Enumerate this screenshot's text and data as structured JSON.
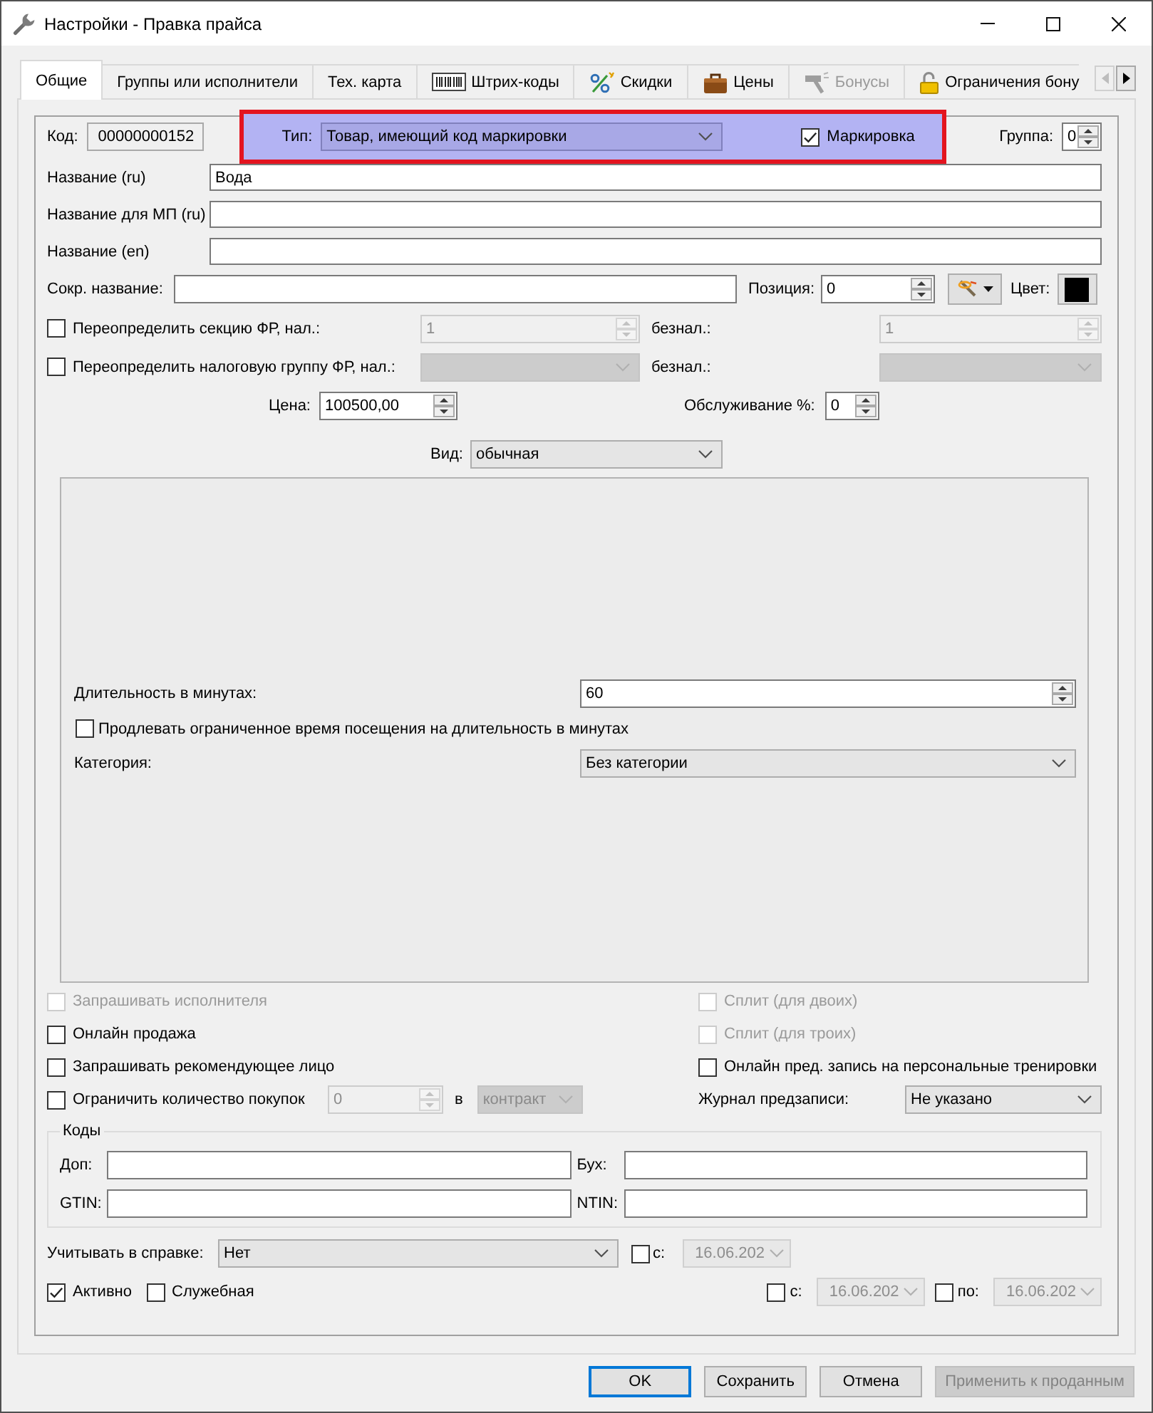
{
  "window": {
    "title": "Настройки - Правка прайса"
  },
  "tabs": [
    {
      "label": "Общие",
      "selected": true,
      "disabled": false,
      "kind": "text"
    },
    {
      "label": "Группы или исполнители",
      "selected": false,
      "disabled": false,
      "kind": "text"
    },
    {
      "label": "Тех. карта",
      "selected": false,
      "disabled": false,
      "kind": "text"
    },
    {
      "label": "Штрих-коды",
      "selected": false,
      "disabled": false,
      "kind": "icon"
    },
    {
      "label": "Скидки",
      "selected": false,
      "disabled": false,
      "kind": "icon"
    },
    {
      "label": "Цены",
      "selected": false,
      "disabled": false,
      "kind": "icon"
    },
    {
      "label": "Бонусы",
      "selected": false,
      "disabled": true,
      "kind": "icon"
    },
    {
      "label": "Ограничения бону",
      "selected": false,
      "disabled": false,
      "kind": "icon"
    }
  ],
  "tab_scroll": {
    "back_disabled": true,
    "forward_disabled": false
  },
  "code": {
    "label": "Код:",
    "value": "00000000152"
  },
  "type": {
    "label": "Тип:",
    "value": "Товар, имеющий код маркировки"
  },
  "marking": {
    "label": "Маркировка",
    "checked": true
  },
  "group": {
    "label": "Группа:",
    "value": "0"
  },
  "names": [
    {
      "label": "Название (ru)",
      "value": "Вода"
    },
    {
      "label": "Название для МП (ru)"
    },
    {
      "label": "Название (en)"
    }
  ],
  "short_name": {
    "label": "Сокр. название:"
  },
  "position": {
    "label": "Позиция:",
    "value": "0"
  },
  "color": {
    "label": "Цвет:",
    "color": "#000000"
  },
  "fr_overrides": [
    {
      "kind": "spin",
      "label": "Переопределить секцию ФР, нал.:",
      "checked": false,
      "cash": {
        "value": "1",
        "disabled": true
      },
      "cashless_label": "безнал.:",
      "cashless": {
        "value": "1",
        "disabled": true
      }
    },
    {
      "kind": "combo",
      "label": "Переопределить налоговую группу ФР, нал.:",
      "checked": false,
      "cash": {
        "disabled": true
      },
      "cashless_label": "безнал.:",
      "cashless": {
        "disabled": true
      }
    }
  ],
  "price": {
    "label": "Цена:",
    "value": "100500,00"
  },
  "service": {
    "label": "Обслуживание %:",
    "value": "0"
  },
  "view": {
    "label": "Вид:",
    "value": "обычная"
  },
  "duration": {
    "label": "Длительность в минутах:",
    "value": "60"
  },
  "extend_visit": {
    "label": "Продлевать ограниченное время посещения на длительность в минутах",
    "checked": false
  },
  "category": {
    "label": "Категория:",
    "value": "Без категории"
  },
  "options_left": [
    {
      "label": "Запрашивать исполнителя",
      "checked": false,
      "disabled": true
    },
    {
      "label": "Онлайн продажа",
      "checked": false,
      "disabled": false
    },
    {
      "label": "Запрашивать рекомендующее лицо",
      "checked": false,
      "disabled": false
    }
  ],
  "options_right": [
    {
      "label": "Сплит (для двоих)",
      "checked": false,
      "disabled": true
    },
    {
      "label": "Сплит (для троих)",
      "checked": false,
      "disabled": true
    },
    {
      "label": "Онлайн пред. запись на персональные тренировки",
      "checked": false,
      "disabled": false
    }
  ],
  "purchase_limit": {
    "label": "Ограничить количество покупок",
    "checked": false,
    "count": {
      "value": "0",
      "disabled": true
    },
    "unit_label": "в",
    "unit": {
      "value": "контракт",
      "disabled": true
    }
  },
  "booking_journal": {
    "label": "Журнал предзаписи:",
    "value": "Не указано"
  },
  "codes": {
    "title": "Коды",
    "fields": [
      {
        "label": "Доп:"
      },
      {
        "label": "Бух:"
      },
      {
        "label": "GTIN:"
      },
      {
        "label": "NTIN:"
      }
    ]
  },
  "report": {
    "label": "Учитывать в справке:",
    "value": "Нет",
    "since": {
      "label": "с:",
      "checked": false,
      "date": {
        "value": "16.06.202",
        "disabled": true
      }
    }
  },
  "active": {
    "label": "Активно",
    "checked": true
  },
  "internal": {
    "label": "Служебная",
    "checked": false
  },
  "period": [
    {
      "label": "с:",
      "checked": false,
      "date": {
        "value": "16.06.202",
        "disabled": true
      }
    },
    {
      "label": "по:",
      "checked": false,
      "date": {
        "value": "16.06.202",
        "disabled": true
      }
    }
  ],
  "buttons": [
    {
      "label": "OK",
      "default": true,
      "disabled": false
    },
    {
      "label": "Сохранить",
      "default": false,
      "disabled": false
    },
    {
      "label": "Отмена",
      "default": false,
      "disabled": false
    },
    {
      "label": "Применить к проданным",
      "default": false,
      "disabled": true
    }
  ]
}
